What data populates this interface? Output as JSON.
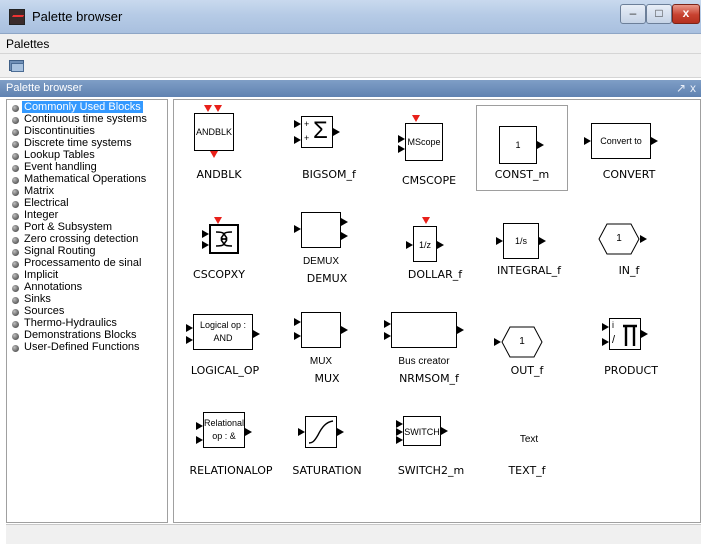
{
  "window": {
    "title": "Palette browser",
    "min": "–",
    "max": "□",
    "close": "x"
  },
  "menubar": {
    "palettes": "Palettes"
  },
  "dock": {
    "title": "Palette browser",
    "undock": "↗",
    "close": "x"
  },
  "tree": {
    "items": [
      "Commonly Used Blocks",
      "Continuous time systems",
      "Discontinuities",
      "Discrete time systems",
      "Lookup Tables",
      "Event handling",
      "Mathematical Operations",
      "Matrix",
      "Electrical",
      "Integer",
      "Port & Subsystem",
      "Zero crossing detection",
      "Signal Routing",
      "Processamento de sinal",
      "Implicit",
      "Annotations",
      "Sinks",
      "Sources",
      "Thermo-Hydraulics",
      "Demonstrations Blocks",
      "User-Defined Functions"
    ],
    "selected_index": 0
  },
  "blocks": [
    {
      "name": "ANDBLK",
      "icon_text": "ANDBLK"
    },
    {
      "name": "BIGSOM_f",
      "icon_text": "Σ",
      "ports": [
        "+",
        "+"
      ]
    },
    {
      "name": "CMSCOPE",
      "icon_text": "MScope"
    },
    {
      "name": "CONST_m",
      "icon_text": "1"
    },
    {
      "name": "CONVERT",
      "icon_text": "Convert to"
    },
    {
      "name": "CSCOPXY",
      "icon_text": ""
    },
    {
      "name": "DEMUX",
      "icon_text": "DEMUX"
    },
    {
      "name": "DOLLAR_f",
      "icon_text": "1/z"
    },
    {
      "name": "INTEGRAL_f",
      "icon_text": "1/s"
    },
    {
      "name": "IN_f",
      "icon_text": "1"
    },
    {
      "name": "LOGICAL_OP",
      "icon_line1": "Logical op :",
      "icon_line2": "AND"
    },
    {
      "name": "MUX",
      "icon_text": "MUX"
    },
    {
      "name": "NRMSOM_f",
      "icon_text": "Bus creator"
    },
    {
      "name": "OUT_f",
      "icon_text": "1"
    },
    {
      "name": "PRODUCT",
      "icon_top": "i",
      "icon_bottom": "/"
    },
    {
      "name": "RELATIONALOP",
      "icon_line1": "Relational",
      "icon_line2": "op : &"
    },
    {
      "name": "SATURATION",
      "icon_text": ""
    },
    {
      "name": "SWITCH2_m",
      "icon_text": "SWITCH"
    },
    {
      "name": "TEXT_f",
      "icon_text": "Text"
    }
  ],
  "colors": {
    "dock_header": "#6f90bb",
    "selection": "#3399ff",
    "event_port": "#e8201a"
  }
}
